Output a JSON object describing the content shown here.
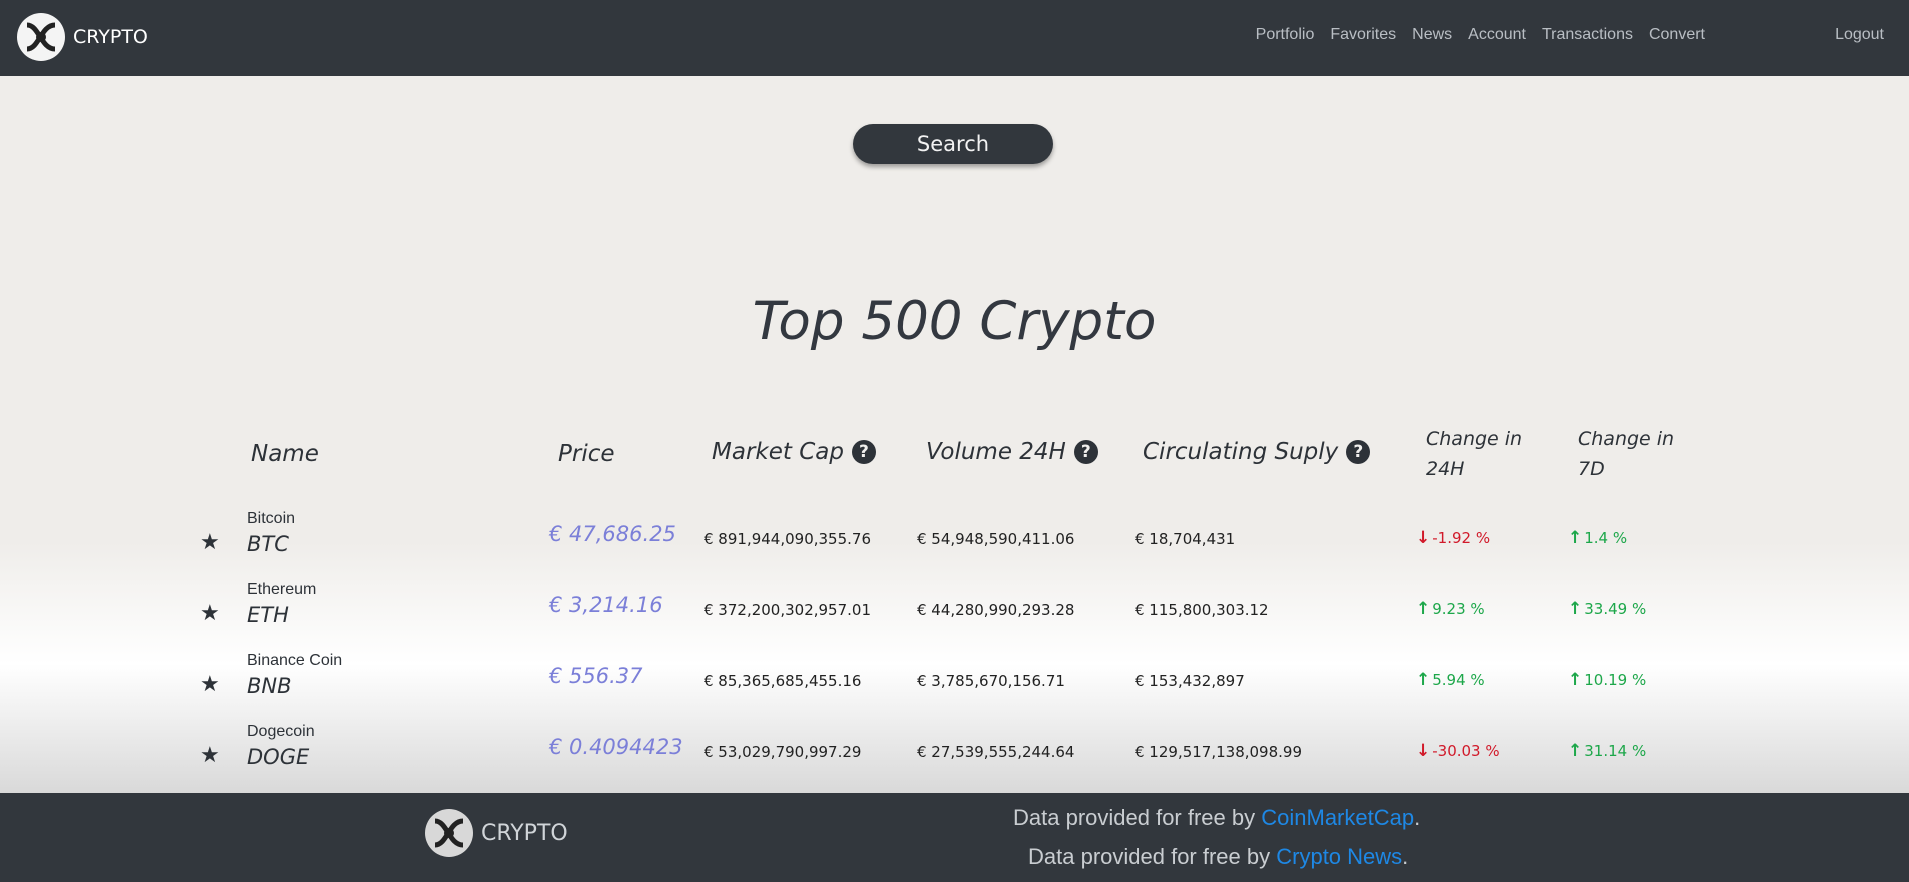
{
  "nav": {
    "brand": "CRYPTO",
    "links": [
      "Portfolio",
      "Favorites",
      "News",
      "Account",
      "Transactions",
      "Convert"
    ],
    "logout": "Logout"
  },
  "search": {
    "label": "Search"
  },
  "title": "Top 500 Crypto",
  "table": {
    "headers": {
      "name": "Name",
      "price": "Price",
      "market_cap": "Market Cap",
      "volume": "Volume 24H",
      "supply": "Circulating Suply",
      "change24_line1": "Change in",
      "change24_line2": "24H",
      "change7_line1": "Change in",
      "change7_line2": "7D"
    },
    "rows": [
      {
        "name": "Bitcoin",
        "symbol": "BTC",
        "price": "€ 47,686.25",
        "market_cap": "€ 891,944,090,355.76",
        "volume": "€ 54,948,590,411.06",
        "supply": "€ 18,704,431",
        "change24": "-1.92 %",
        "change24_dir": "down",
        "change7": "1.4 %",
        "change7_dir": "up"
      },
      {
        "name": "Ethereum",
        "symbol": "ETH",
        "price": "€ 3,214.16",
        "market_cap": "€ 372,200,302,957.01",
        "volume": "€ 44,280,990,293.28",
        "supply": "€ 115,800,303.12",
        "change24": "9.23 %",
        "change24_dir": "up",
        "change7": "33.49 %",
        "change7_dir": "up"
      },
      {
        "name": "Binance Coin",
        "symbol": "BNB",
        "price": "€ 556.37",
        "market_cap": "€ 85,365,685,455.16",
        "volume": "€ 3,785,670,156.71",
        "supply": "€ 153,432,897",
        "change24": "5.94 %",
        "change24_dir": "up",
        "change7": "10.19 %",
        "change7_dir": "up"
      },
      {
        "name": "Dogecoin",
        "symbol": "DOGE",
        "price": "€ 0.4094423",
        "market_cap": "€ 53,029,790,997.29",
        "volume": "€ 27,539,555,244.64",
        "supply": "€ 129,517,138,098.99",
        "change24": "-30.03 %",
        "change24_dir": "down",
        "change7": "31.14 %",
        "change7_dir": "up"
      }
    ]
  },
  "footer": {
    "brand": "CRYPTO",
    "line1_prefix": "Data provided for free by ",
    "line1_link": "CoinMarketCap",
    "line2_prefix": "Data provided for free by ",
    "line2_link": "Crypto News",
    "suffix": "."
  },
  "colors": {
    "nav_bg": "#32373d",
    "price": "#7b7fd8",
    "up": "#1da74a",
    "down": "#d11a2a",
    "link": "#1e88e5"
  },
  "icons": [
    "logo-icon",
    "star-icon",
    "help-icon",
    "arrow-up-icon",
    "arrow-down-icon"
  ]
}
